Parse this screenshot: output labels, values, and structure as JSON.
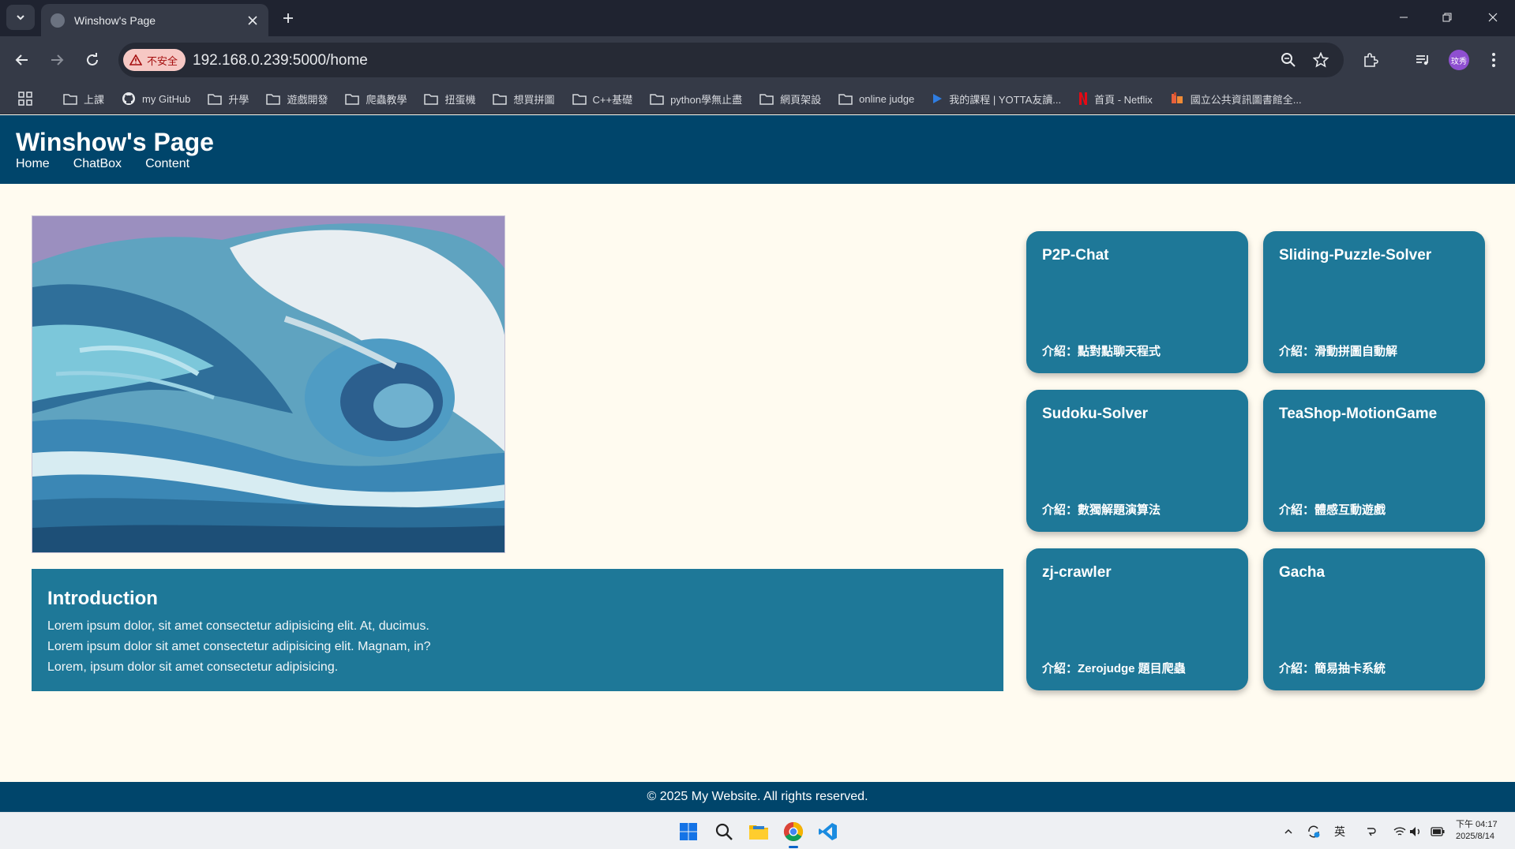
{
  "browser": {
    "tab_title": "Winshow's Page",
    "security_label": "不安全",
    "url": "192.168.0.239:5000/home",
    "profile_initials": "玟秀",
    "bookmarks": [
      {
        "label": "上課",
        "icon": "folder-icon"
      },
      {
        "label": "my GitHub",
        "icon": "github-icon"
      },
      {
        "label": "升學",
        "icon": "folder-icon"
      },
      {
        "label": "遊戲開發",
        "icon": "folder-icon"
      },
      {
        "label": "爬蟲教學",
        "icon": "folder-icon"
      },
      {
        "label": "扭蛋機",
        "icon": "folder-icon"
      },
      {
        "label": "想買拼圖",
        "icon": "folder-icon"
      },
      {
        "label": "C++基礎",
        "icon": "folder-icon"
      },
      {
        "label": "python學無止盡",
        "icon": "folder-icon"
      },
      {
        "label": "網頁架設",
        "icon": "folder-icon"
      },
      {
        "label": "online judge",
        "icon": "folder-icon"
      },
      {
        "label": "我的課程 | YOTTA友讀...",
        "icon": "yotta-icon"
      },
      {
        "label": "首頁 - Netflix",
        "icon": "netflix-icon"
      },
      {
        "label": "國立公共資訊圖書館全...",
        "icon": "library-icon"
      }
    ]
  },
  "site": {
    "title": "Winshow's Page",
    "nav": [
      "Home",
      "ChatBox",
      "Content"
    ],
    "intro": {
      "heading": "Introduction",
      "lines": [
        "Lorem ipsum dolor, sit amet consectetur adipisicing elit. At, ducimus.",
        "Lorem ipsum dolor sit amet consectetur adipisicing elit. Magnam, in?",
        "Lorem, ipsum dolor sit amet consectetur adipisicing."
      ]
    },
    "projects": [
      {
        "title": "P2P-Chat",
        "desc": "介紹：點對點聊天程式"
      },
      {
        "title": "Sliding-Puzzle-Solver",
        "desc": "介紹：滑動拼圖自動解"
      },
      {
        "title": "Sudoku-Solver",
        "desc": "介紹：數獨解題演算法"
      },
      {
        "title": "TeaShop-MotionGame",
        "desc": "介紹：體感互動遊戲"
      },
      {
        "title": "zj-crawler",
        "desc": "介紹：Zerojudge 題目爬蟲"
      },
      {
        "title": "Gacha",
        "desc": "介紹：簡易抽卡系統"
      }
    ],
    "footer": "© 2025 My Website. All rights reserved."
  },
  "taskbar": {
    "apps": [
      "start-icon",
      "search-icon",
      "file-explorer-icon",
      "chrome-icon",
      "vscode-icon"
    ],
    "ime": "英",
    "time": "下午 04:17",
    "date": "2025/8/14"
  },
  "colors": {
    "header": "#00456b",
    "card": "#1e7898",
    "page_bg": "#fffbf0"
  }
}
